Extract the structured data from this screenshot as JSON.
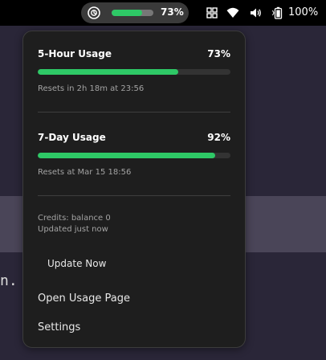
{
  "topbar": {
    "usage_indicator": {
      "percent_label": "73%",
      "fill_fraction": 0.73,
      "icon": "claude-logo-icon"
    },
    "tray": {
      "icons": [
        "apps-grid-icon",
        "wifi-icon",
        "volume-icon",
        "battery-icon"
      ],
      "battery_label": "100%"
    }
  },
  "popup": {
    "five_hour": {
      "title": "5-Hour Usage",
      "percent_label": "73%",
      "fill_fraction": 0.73,
      "resets": "Resets in 2h 18m at 23:56"
    },
    "seven_day": {
      "title": "7-Day Usage",
      "percent_label": "92%",
      "fill_fraction": 0.92,
      "resets": "Resets at Mar 15 18:56"
    },
    "credits": "Credits: balance 0",
    "updated": "Updated just now",
    "menu": {
      "update_now": "Update Now",
      "open_usage_page": "Open Usage Page",
      "settings": "Settings"
    }
  },
  "background": {
    "terminal_fragment": "n."
  },
  "colors": {
    "accent_green": "#2ec866",
    "popup_bg": "#1e1e1e",
    "topbar_bg": "#000000"
  }
}
